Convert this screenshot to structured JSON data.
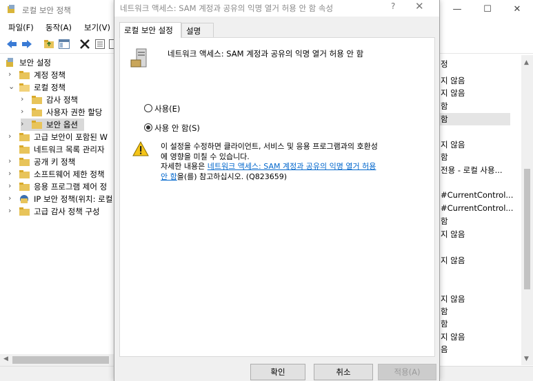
{
  "main_window": {
    "title": "로컬 보안 정책",
    "controls": {
      "minimize": "—",
      "maximize": "☐",
      "close": "✕"
    },
    "menu": [
      "파일(F)",
      "동작(A)",
      "보기(V)"
    ],
    "tree": [
      {
        "label": "보안 설정",
        "chevron": "",
        "level": 0
      },
      {
        "label": "계정 정책",
        "chevron": "›",
        "level": 1
      },
      {
        "label": "로컬 정책",
        "chevron": "⌄",
        "level": 1
      },
      {
        "label": "감사 정책",
        "chevron": "›",
        "level": 2
      },
      {
        "label": "사용자 권한 할당",
        "chevron": "›",
        "level": 2
      },
      {
        "label": "보안 옵션",
        "chevron": "›",
        "level": 2
      },
      {
        "label": "고급 보안이 포함된 W",
        "chevron": "›",
        "level": 1
      },
      {
        "label": "네트워크 목록 관리자",
        "chevron": "",
        "level": 1
      },
      {
        "label": "공개 키 정책",
        "chevron": "›",
        "level": 1
      },
      {
        "label": "소프트웨어 제한 정책",
        "chevron": "›",
        "level": 1
      },
      {
        "label": "응용 프로그램 제어 정",
        "chevron": "›",
        "level": 1
      },
      {
        "label": "IP 보안 정책(위치: 로컬",
        "chevron": "›",
        "level": 1
      },
      {
        "label": "고급 감사 정책 구성",
        "chevron": "›",
        "level": 1
      }
    ],
    "right_column": [
      "정",
      "지 않음",
      "지 않음",
      "함",
      "함",
      "지 않음",
      "함",
      "전용 - 로컬 사용...",
      "#CurrentControl...",
      "#CurrentControl...",
      "함",
      "지 않음",
      "지 않음",
      "지 않음",
      "함",
      "함",
      "지 않음",
      "음"
    ]
  },
  "dialog": {
    "title": "네트워크 액세스: SAM 계정과 공유의 익명 열거 허용 안 함 속성",
    "help": "?",
    "close": "✕",
    "tabs": [
      "로컬 보안 설정",
      "설명"
    ],
    "policy_name": "네트워크 액세스: SAM 계정과 공유의 익명 열거 허용 안 함",
    "options": [
      {
        "label": "사용(E)",
        "checked": false
      },
      {
        "label": "사용 안 함(S)",
        "checked": true
      }
    ],
    "warning": {
      "line1": "이 설정을 수정하면 클라이언트, 서비스 및 응용 프로그램과의 호환성",
      "line2": "에 영향을 미칠 수 있습니다.",
      "line3_prefix": "자세한 내용은 ",
      "link_part1": "네트워크 액세스: SAM 계정과 공유의 익명 열거 허용",
      "link_part2": "안 함",
      "line4_suffix": "을(를) 참고하십시오. (Q823659)"
    },
    "buttons": {
      "ok": "확인",
      "cancel": "취소",
      "apply": "적용(A)"
    }
  }
}
